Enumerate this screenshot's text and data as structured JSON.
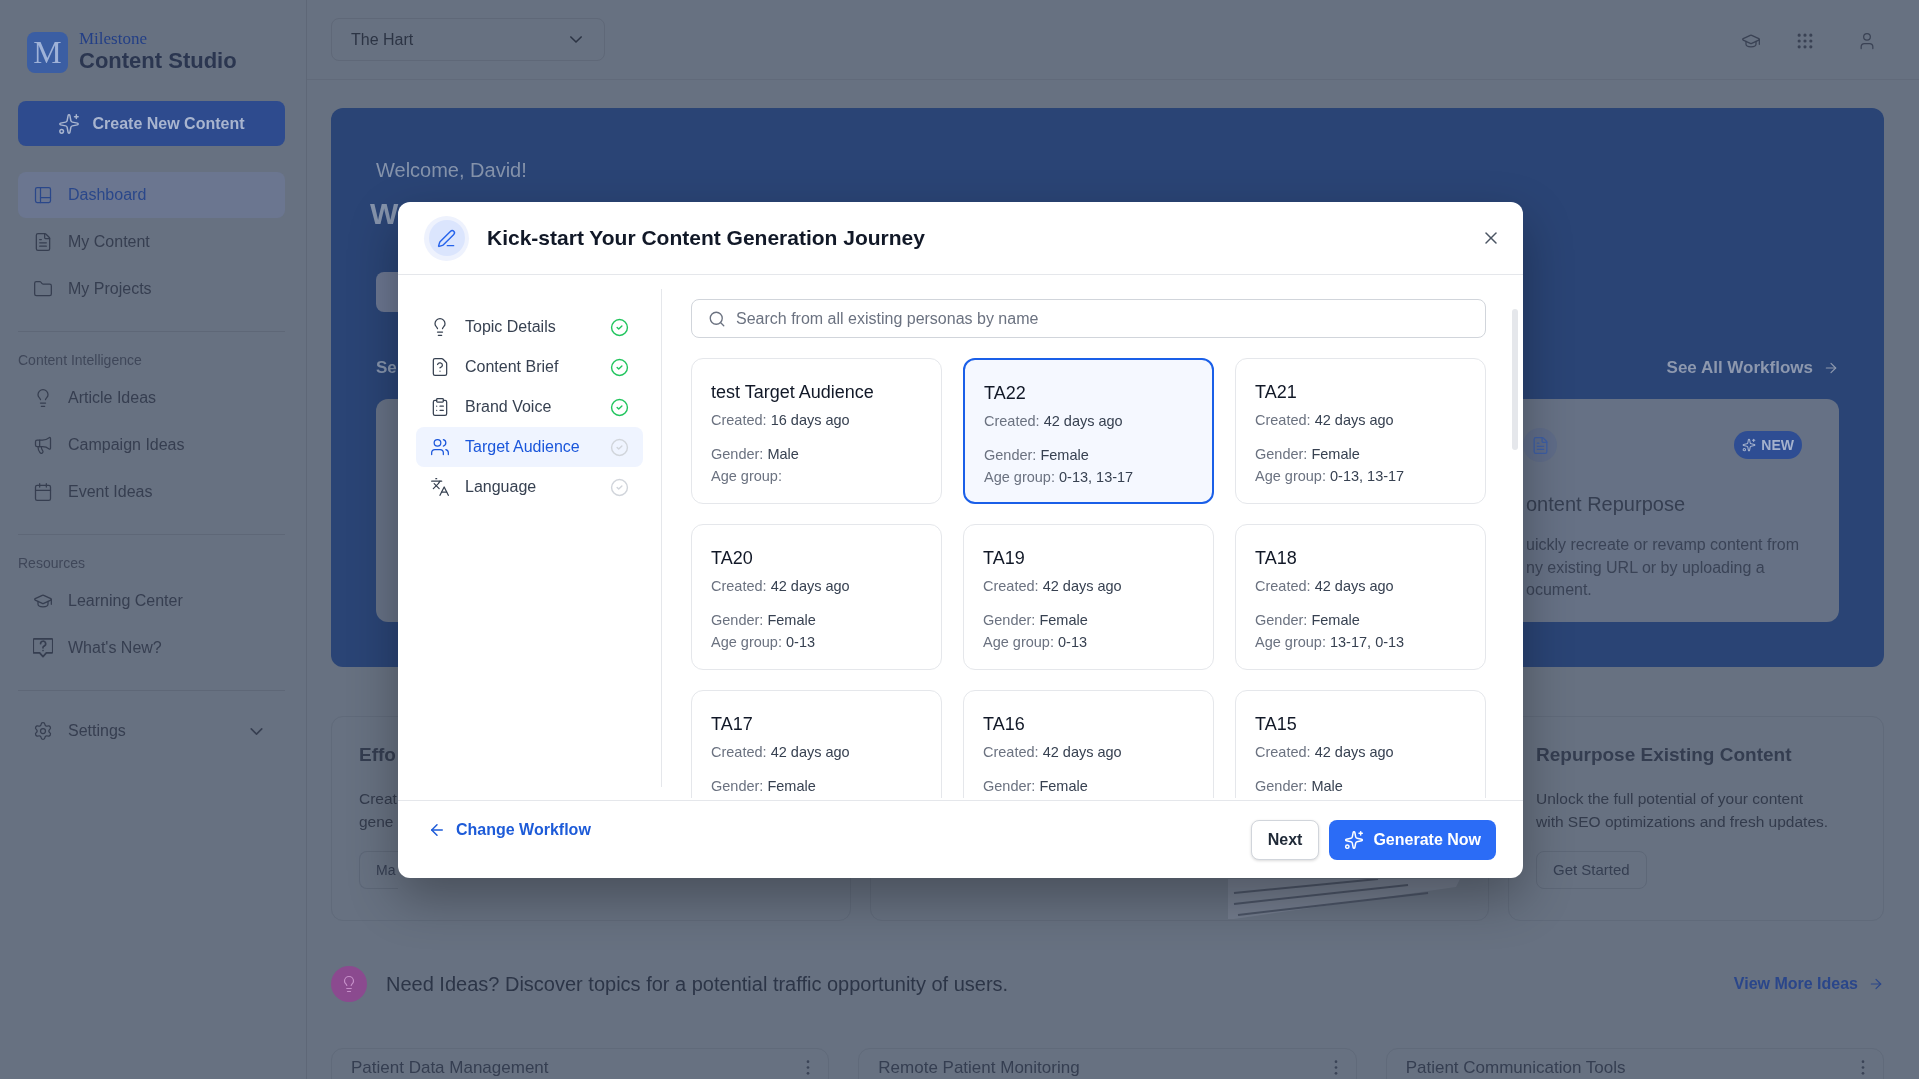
{
  "sidebar": {
    "logo": {
      "letter": "M",
      "brand": "Milestone",
      "product": "Content Studio"
    },
    "create_button": "Create New Content",
    "sections": [
      {
        "items": [
          {
            "label": "Dashboard",
            "selected": true
          },
          {
            "label": "My Content",
            "selected": false
          },
          {
            "label": "My Projects",
            "selected": false
          }
        ]
      },
      {
        "heading": "Content Intelligence",
        "items": [
          {
            "label": "Article Ideas",
            "selected": false
          },
          {
            "label": "Campaign Ideas",
            "selected": false
          },
          {
            "label": "Event Ideas",
            "selected": false
          }
        ]
      },
      {
        "heading": "Resources",
        "items": [
          {
            "label": "Learning Center",
            "selected": false
          },
          {
            "label": "What's New?",
            "selected": false
          }
        ]
      }
    ],
    "settings": {
      "label": "Settings",
      "expanded": false
    }
  },
  "top_bar": {
    "site_selector": {
      "value": "The Hart"
    }
  },
  "hero": {
    "greeting": "Welcome, David!",
    "heading": "W",
    "section_title": "Se",
    "see_all_link": "See All Workflows",
    "workflow_card": {
      "title": "ontent Repurpose",
      "badge": "NEW",
      "description_lines": [
        "uickly recreate or revamp content from",
        "ny existing URL or by uploading a",
        "ocument."
      ]
    }
  },
  "feature_cards": [
    {
      "kind": "text",
      "title": "Effo",
      "description_lines": [
        "Creat",
        "gene"
      ],
      "button": "Ma"
    },
    {
      "kind": "image"
    },
    {
      "kind": "text",
      "title": "Repurpose Existing Content",
      "description_lines": [
        "Unlock the full potential of your content",
        "with SEO optimizations and fresh updates."
      ],
      "button": "Get Started"
    }
  ],
  "ideas_banner": {
    "text": "Need Ideas? Discover topics for a potential traffic opportunity of users.",
    "link": "View More Ideas"
  },
  "idea_cards": [
    {
      "title": "Patient Data Management"
    },
    {
      "title": "Remote Patient Monitoring"
    },
    {
      "title": "Patient Communication Tools"
    }
  ],
  "modal": {
    "title": "Kick-start Your Content Generation Journey",
    "steps": [
      {
        "label": "Topic Details",
        "done": true,
        "selected": false
      },
      {
        "label": "Content Brief",
        "done": true,
        "selected": false
      },
      {
        "label": "Brand Voice",
        "done": true,
        "selected": false
      },
      {
        "label": "Target Audience",
        "done": false,
        "selected": true
      },
      {
        "label": "Language",
        "done": false,
        "selected": false
      }
    ],
    "search": {
      "placeholder": "Search from all existing personas by name"
    },
    "personas": [
      {
        "name": "test Target Audience",
        "selected": false,
        "fields": [
          {
            "label": "Created:",
            "value": "16 days ago"
          },
          {
            "label": "Gender:",
            "value": "Male"
          },
          {
            "label": "Age group:"
          }
        ]
      },
      {
        "name": "TA22",
        "selected": true,
        "fields": [
          {
            "label": "Created:",
            "value": "42 days ago"
          },
          {
            "label": "Gender:",
            "value": "Female"
          },
          {
            "label": "Age group:",
            "value": "0-13, 13-17"
          }
        ]
      },
      {
        "name": "TA21",
        "selected": false,
        "fields": [
          {
            "label": "Created:",
            "value": "42 days ago"
          },
          {
            "label": "Gender:",
            "value": "Female"
          },
          {
            "label": "Age group:",
            "value": "0-13, 13-17"
          }
        ]
      },
      {
        "name": "TA20",
        "selected": false,
        "fields": [
          {
            "label": "Created:",
            "value": "42 days ago"
          },
          {
            "label": "Gender:",
            "value": "Female"
          },
          {
            "label": "Age group:",
            "value": "0-13"
          }
        ]
      },
      {
        "name": "TA19",
        "selected": false,
        "fields": [
          {
            "label": "Created:",
            "value": "42 days ago"
          },
          {
            "label": "Gender:",
            "value": "Female"
          },
          {
            "label": "Age group:",
            "value": "0-13"
          }
        ]
      },
      {
        "name": "TA18",
        "selected": false,
        "fields": [
          {
            "label": "Created:",
            "value": "42 days ago"
          },
          {
            "label": "Gender:",
            "value": "Female"
          },
          {
            "label": "Age group:",
            "value": "13-17, 0-13"
          }
        ]
      },
      {
        "name": "TA17",
        "selected": false,
        "fields": [
          {
            "label": "Created:",
            "value": "42 days ago"
          },
          {
            "label": "Gender:",
            "value": "Female"
          }
        ]
      },
      {
        "name": "TA16",
        "selected": false,
        "fields": [
          {
            "label": "Created:",
            "value": "42 days ago"
          },
          {
            "label": "Gender:",
            "value": "Female"
          }
        ]
      },
      {
        "name": "TA15",
        "selected": false,
        "fields": [
          {
            "label": "Created:",
            "value": "42 days ago"
          },
          {
            "label": "Gender:",
            "value": "Male"
          }
        ]
      }
    ],
    "back_link": "Change Workflow",
    "next_button": "Next",
    "generate_button": "Generate Now"
  }
}
